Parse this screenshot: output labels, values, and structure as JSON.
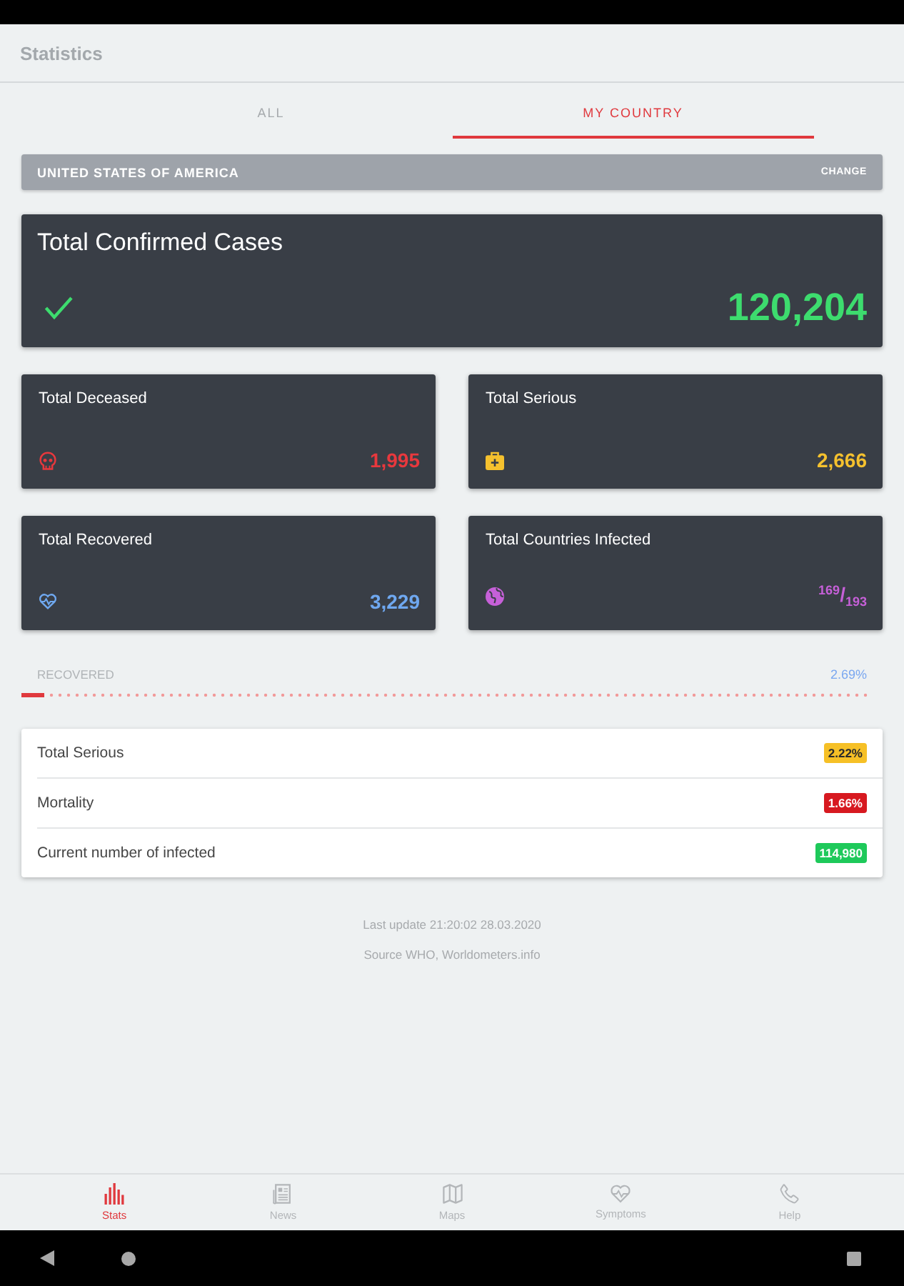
{
  "app_bar": {
    "title": "Statistics"
  },
  "tabs": [
    {
      "label": "ALL",
      "selected": false
    },
    {
      "label": "MY COUNTRY",
      "selected": true
    }
  ],
  "country_bar": {
    "country": "UNITED STATES OF AMERICA",
    "action": "CHANGE"
  },
  "summary": {
    "title": "Total Confirmed Cases",
    "value": "120,204"
  },
  "stats": [
    {
      "kind": "deceased",
      "title": "Total Deceased",
      "value": "1,995",
      "color": "#e8383d"
    },
    {
      "kind": "serious",
      "title": "Total Serious",
      "value": "2,666",
      "color": "#f5c12e"
    },
    {
      "kind": "recovered",
      "title": "Total Recovered",
      "value": "3,229",
      "color": "#6fa8f0"
    },
    {
      "kind": "countries",
      "title": "Total Countries Infected",
      "value": "$^{169}$/$_{193}$",
      "color": "#c660d8"
    }
  ],
  "progress": {
    "label": "RECOVERED",
    "reading": "2.69%",
    "level": 0.0269
  },
  "rates": [
    {
      "label": "Total Serious",
      "value": "2.22%",
      "color": "#f6c026"
    },
    {
      "label": "Mortality",
      "value": "1.66%",
      "color": "#d71920"
    },
    {
      "label": "Current number of infected",
      "value": "114,980",
      "color": "#1ec95a"
    }
  ],
  "footer": [
    "Last update 21:20:02 28.03.2020",
    "Source WHO, Worldometers.info"
  ],
  "nav": [
    {
      "label": "Stats",
      "kind": "chart",
      "selected": true
    },
    {
      "label": "News",
      "kind": "newspaper",
      "selected": false
    },
    {
      "label": "Maps",
      "kind": "map",
      "selected": false
    },
    {
      "label": "Symptoms",
      "kind": "heart",
      "selected": false
    },
    {
      "label": "Help",
      "kind": "phone",
      "selected": false
    }
  ]
}
